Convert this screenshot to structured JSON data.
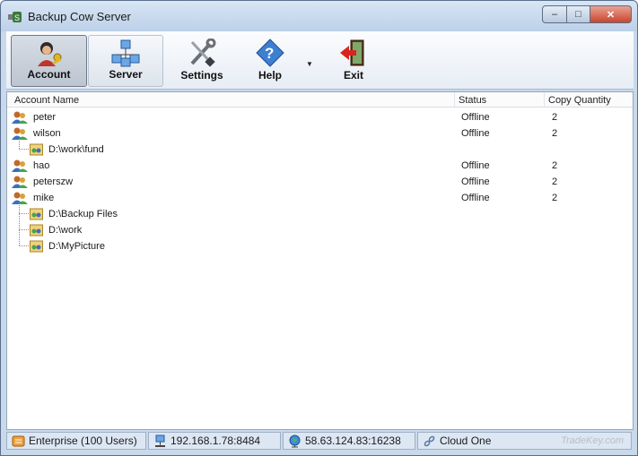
{
  "window": {
    "title": "Backup Cow Server"
  },
  "window_controls": {
    "minimize": "–",
    "maximize": "□",
    "close": "✕"
  },
  "toolbar": {
    "account_label": "Account",
    "server_label": "Server",
    "settings_label": "Settings",
    "help_label": "Help",
    "help_dropdown": "▼",
    "exit_label": "Exit"
  },
  "list": {
    "columns": {
      "name": "Account Name",
      "status": "Status",
      "copy": "Copy Quantity"
    },
    "rows": [
      {
        "name": "peter",
        "status": "Offline",
        "copy": "2"
      },
      {
        "name": "wilson",
        "status": "Offline",
        "copy": "2"
      },
      {
        "path": "D:\\work\\fund"
      },
      {
        "name": "hao",
        "status": "Offline",
        "copy": "2"
      },
      {
        "name": "peterszw",
        "status": "Offline",
        "copy": "2"
      },
      {
        "name": "mike",
        "status": "Offline",
        "copy": "2"
      },
      {
        "path": "D:\\Backup Files"
      },
      {
        "path": "D:\\work"
      },
      {
        "path": "D:\\MyPicture"
      }
    ]
  },
  "statusbar": {
    "edition": "Enterprise (100 Users)",
    "local_address": "192.168.1.78:8484",
    "public_address": "58.63.124.83:16238",
    "cloud": "Cloud One"
  },
  "watermark": "TradeKey.com",
  "colors": {
    "accent": "#c9d9ec",
    "close_button": "#c9452d"
  }
}
